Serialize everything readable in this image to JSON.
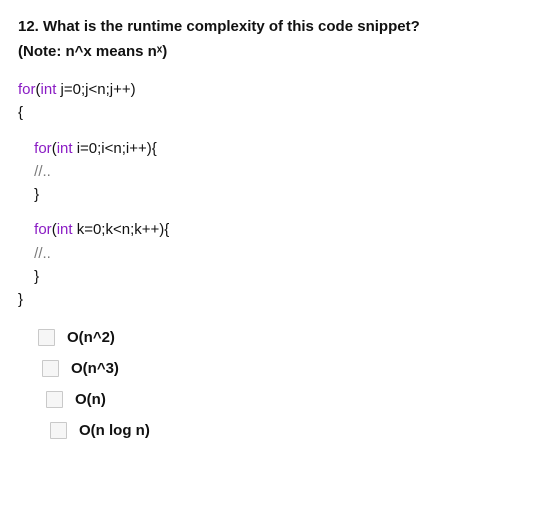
{
  "question": {
    "number_title": "12. What is the runtime complexity of this code snippet?",
    "note": "(Note: n^x means nˣ)"
  },
  "code": {
    "l1_for": "for",
    "l1_int": "int",
    "l1_rest": " j=0;j<n;j++)",
    "l2": "{",
    "l3_for": "for",
    "l3_int": "int",
    "l3_rest": " i=0;i<n;i++){",
    "l4_comment": "//..",
    "l5": "}",
    "l6_for": "for",
    "l6_int": "int",
    "l6_rest": " k=0;k<n;k++){",
    "l7_comment": "//..",
    "l8": "}",
    "l9": "}"
  },
  "options": [
    {
      "label": "O(n^2)"
    },
    {
      "label": "O(n^3)"
    },
    {
      "label": "O(n)"
    },
    {
      "label": "O(n log n)"
    }
  ]
}
